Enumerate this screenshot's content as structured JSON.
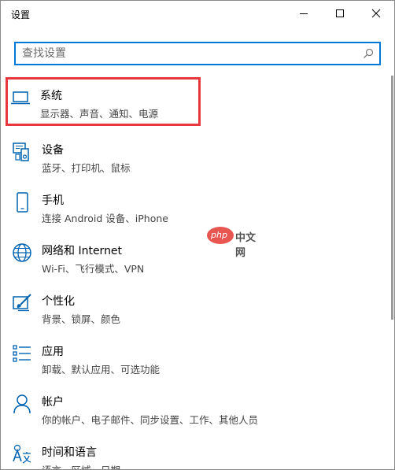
{
  "window": {
    "title": "设置"
  },
  "search": {
    "placeholder": "查找设置"
  },
  "items": [
    {
      "title": "系统",
      "desc": "显示器、声音、通知、电源",
      "icon": "laptop-icon",
      "highlighted": true
    },
    {
      "title": "设备",
      "desc": "蓝牙、打印机、鼠标",
      "icon": "devices-icon"
    },
    {
      "title": "手机",
      "desc": "连接 Android 设备、iPhone",
      "icon": "phone-icon"
    },
    {
      "title": "网络和 Internet",
      "desc": "Wi-Fi、飞行模式、VPN",
      "icon": "globe-icon"
    },
    {
      "title": "个性化",
      "desc": "背景、锁屏、颜色",
      "icon": "paint-icon"
    },
    {
      "title": "应用",
      "desc": "卸载、默认应用、可选功能",
      "icon": "apps-icon"
    },
    {
      "title": "帐户",
      "desc": "你的帐户、电子邮件、同步设置、工作、其他人员",
      "icon": "person-icon"
    },
    {
      "title": "时间和语言",
      "desc": "语言、区域、日期",
      "icon": "time-language-icon"
    }
  ],
  "watermark": {
    "logo_text": "php",
    "text": "中文网"
  },
  "colors": {
    "accent": "#0078d7",
    "highlight_border": "#e8383d"
  }
}
